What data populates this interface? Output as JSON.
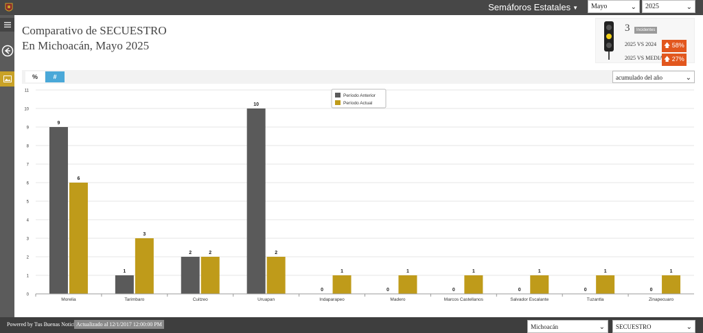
{
  "header": {
    "menu_label": "Semáforos Estatales",
    "month": "Mayo",
    "year": "2025"
  },
  "title": {
    "line1": "Comparativo de SECUESTRO",
    "line2": "En Michoacán, Mayo 2025"
  },
  "kpi": {
    "count": "3",
    "count_label": "Incidentes",
    "row1_label": "2025 VS 2024",
    "row1_value": "58%",
    "row2_label": "2025 VS MEDIA",
    "row2_value": "27%"
  },
  "controls": {
    "percent_tab": "%",
    "number_tab": "#",
    "mode_select": "acumulado del año"
  },
  "footer": {
    "powered_by": "Powered by",
    "powered_name": "Tus Buenas Noticias",
    "updated": "Actualizado al 12/1/2017 12:00:00 PM",
    "region": "Michoacán",
    "crime": "SECUESTRO"
  },
  "colors": {
    "previous": "#5a5a5a",
    "current": "#bf9b1a",
    "accent_blue": "#4aa8d8",
    "badge_orange": "#e2571e"
  },
  "chart_data": {
    "type": "bar",
    "categories": [
      "Morelia",
      "Tarimbaro",
      "Cuitzeo",
      "Uruapan",
      "Indaparapeo",
      "Madero",
      "Marcos Castellanos",
      "Salvador Escalante",
      "Tuzantla",
      "Zinapecuaro"
    ],
    "series": [
      {
        "name": "Período Anterior",
        "values": [
          9,
          1,
          2,
          10,
          0,
          0,
          0,
          0,
          0,
          0
        ]
      },
      {
        "name": "Período Actual",
        "values": [
          6,
          3,
          2,
          2,
          1,
          1,
          1,
          1,
          1,
          1
        ]
      }
    ],
    "ylim": [
      0,
      11
    ],
    "yticks": [
      0,
      1,
      2,
      3,
      4,
      5,
      6,
      7,
      8,
      9,
      10,
      11
    ],
    "legend_position": "top-center",
    "grid": true
  }
}
